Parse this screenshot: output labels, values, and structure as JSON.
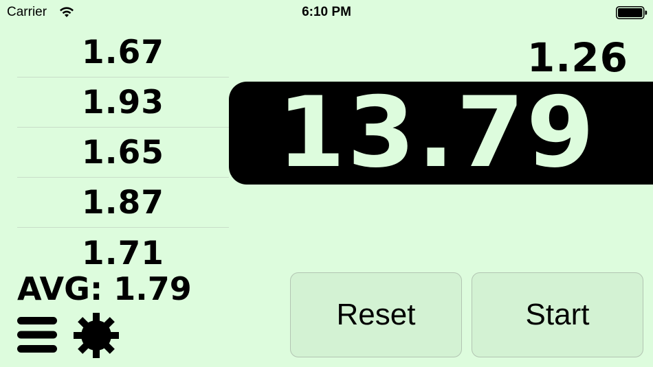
{
  "status_bar": {
    "carrier": "Carrier",
    "time": "6:10 PM",
    "wifi_icon": "wifi-icon",
    "battery_icon": "battery-icon"
  },
  "laps": [
    "1.67",
    "1.93",
    "1.65",
    "1.87",
    "1.71"
  ],
  "average": {
    "text": "AVG: 1.79"
  },
  "timer": {
    "last_lap": "1.26",
    "main": "13.79"
  },
  "buttons": {
    "reset": "Reset",
    "start": "Start"
  },
  "toolbar": {
    "menu_icon": "menu-icon",
    "settings_icon": "gear-icon"
  },
  "colors": {
    "background": "#ddfcdd",
    "timer_background": "#000000",
    "timer_text": "#ddfcdd",
    "button_background": "#d3f2d3"
  }
}
